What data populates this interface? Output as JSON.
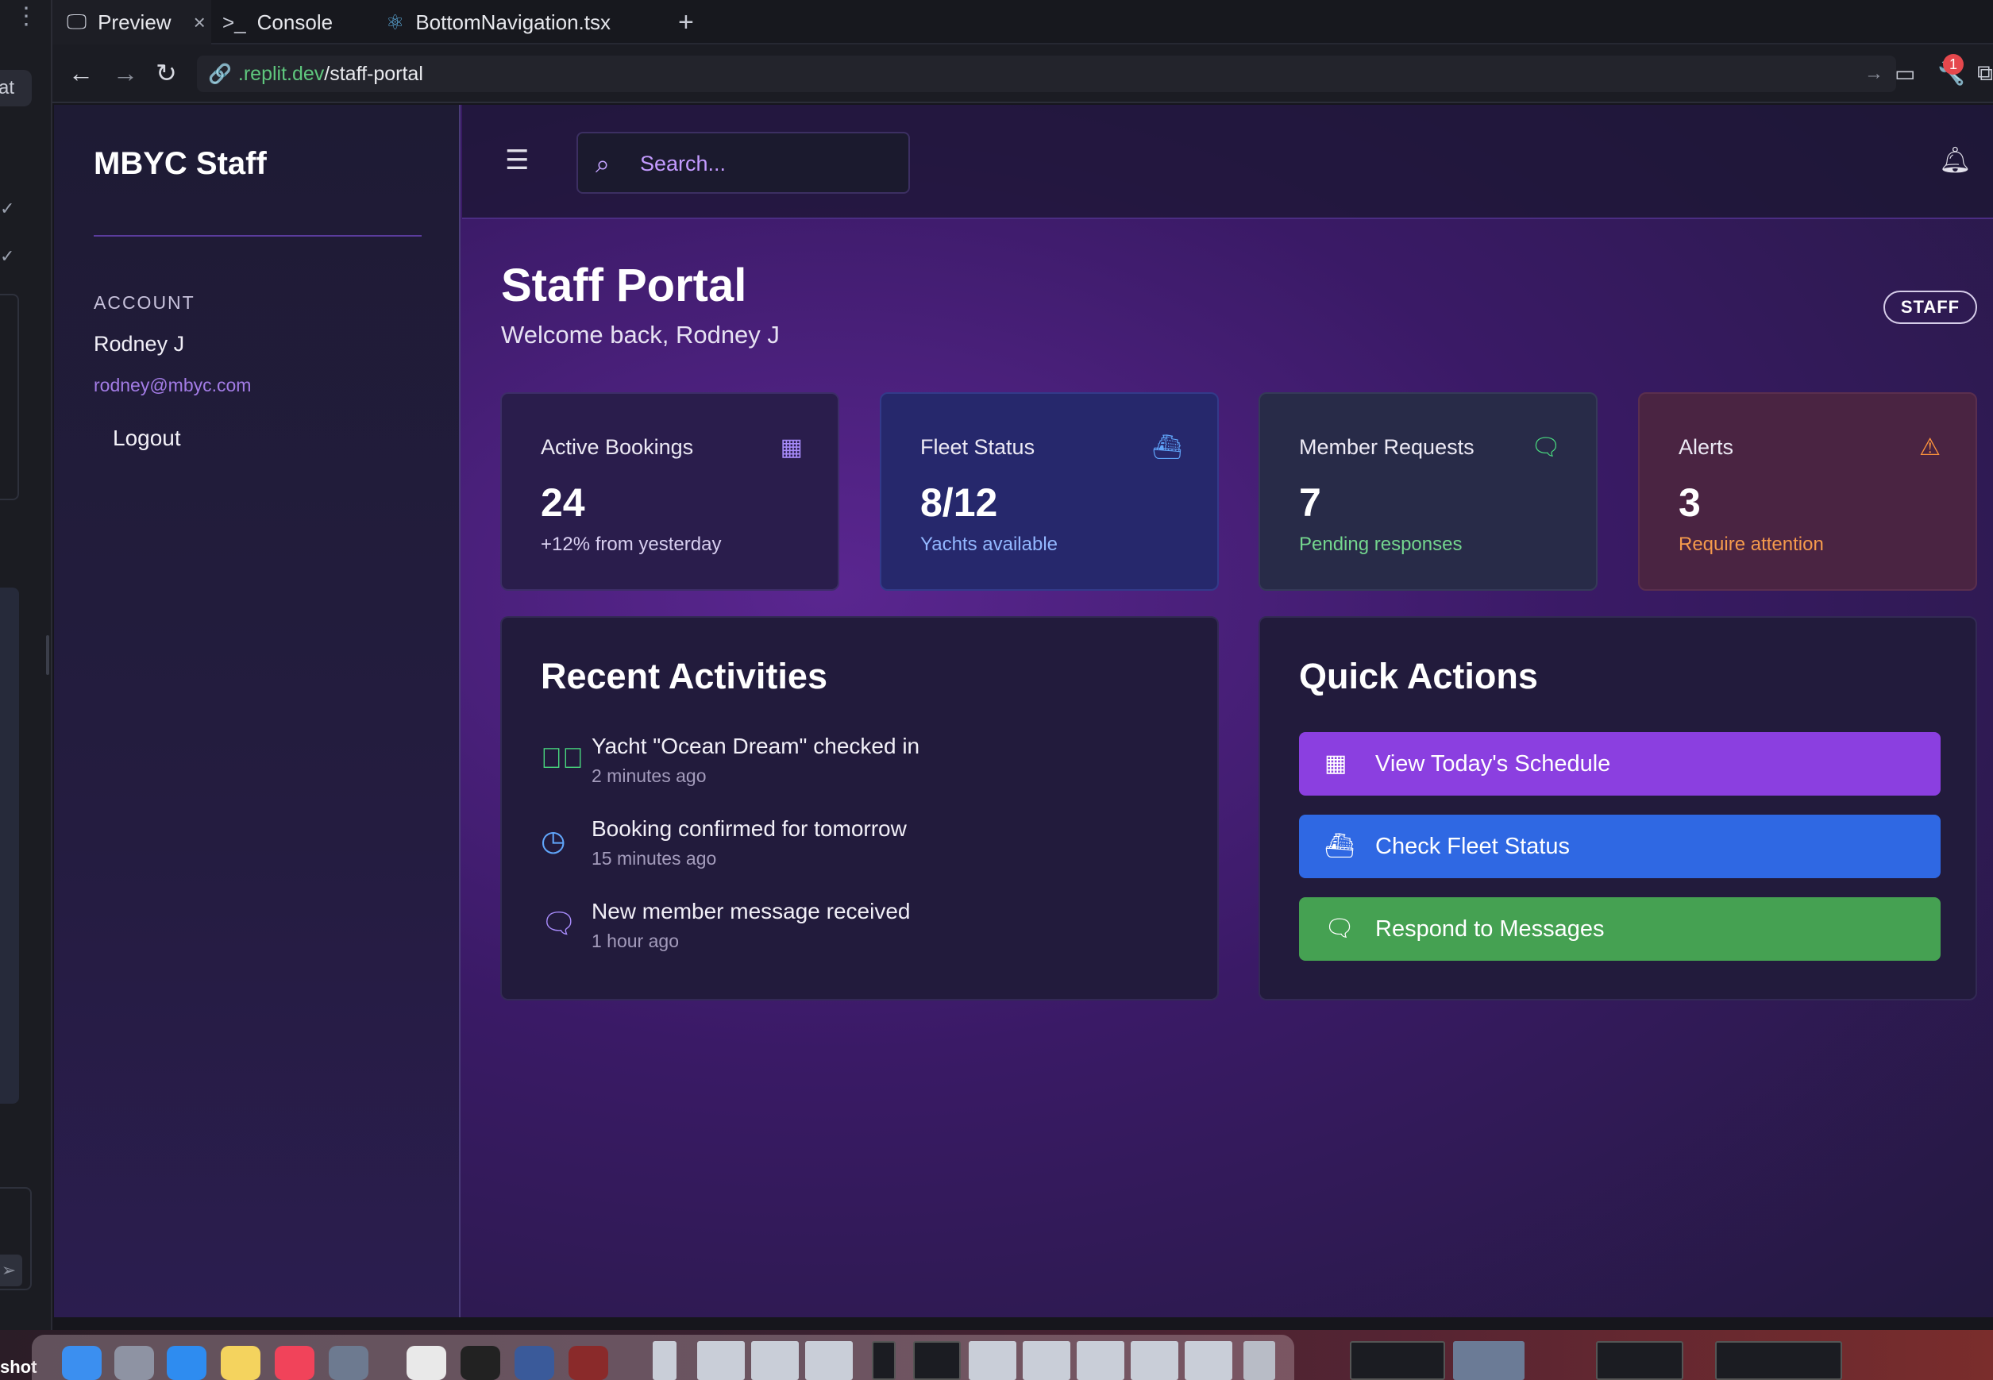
{
  "browser": {
    "tabs": [
      {
        "label": "Preview",
        "icon": "monitor-icon"
      },
      {
        "label": "Console",
        "icon": "terminal-icon"
      },
      {
        "label": "BottomNavigation.tsx",
        "icon": "react-icon"
      }
    ],
    "url_domain": ".replit.dev",
    "url_path": "/staff-portal",
    "notification_count": "1",
    "side_chat_label": "at"
  },
  "sidebar": {
    "brand": "MBYC Staff",
    "account_heading": "ACCOUNT",
    "user_name": "Rodney J",
    "user_email": "rodney@mbyc.com",
    "logout": "Logout"
  },
  "header": {
    "search_placeholder": "Search..."
  },
  "page": {
    "title": "Staff Portal",
    "subtitle": "Welcome back, Rodney J",
    "role_badge": "STAFF"
  },
  "stats": [
    {
      "label": "Active Bookings",
      "value": "24",
      "sub": "+12% from yesterday",
      "icon": "calendar-icon",
      "accent": "#a78bfa"
    },
    {
      "label": "Fleet Status",
      "value": "8/12",
      "sub": "Yachts available",
      "icon": "ship-icon",
      "accent": "#60a5fa"
    },
    {
      "label": "Member Requests",
      "value": "7",
      "sub": "Pending responses",
      "icon": "message-icon",
      "accent": "#4ade80"
    },
    {
      "label": "Alerts",
      "value": "3",
      "sub": "Require attention",
      "icon": "alert-triangle-icon",
      "accent": "#fb923c"
    }
  ],
  "recent": {
    "title": "Recent Activities",
    "items": [
      {
        "text": "Yacht \"Ocean Dream\" checked in",
        "time": "2 minutes ago",
        "icon": "check-circle-icon",
        "color": "#4ade80"
      },
      {
        "text": "Booking confirmed for tomorrow",
        "time": "15 minutes ago",
        "icon": "clock-icon",
        "color": "#60a5fa"
      },
      {
        "text": "New member message received",
        "time": "1 hour ago",
        "icon": "message-icon",
        "color": "#a78bfa"
      }
    ]
  },
  "quick": {
    "title": "Quick Actions",
    "buttons": [
      {
        "label": "View Today's Schedule",
        "icon": "calendar-icon",
        "color": "#8b3fe0"
      },
      {
        "label": "Check Fleet Status",
        "icon": "ship-icon",
        "color": "#2f68e3"
      },
      {
        "label": "Respond to Messages",
        "icon": "message-icon",
        "color": "#45a152"
      }
    ]
  },
  "dock": {
    "label": "shot"
  }
}
